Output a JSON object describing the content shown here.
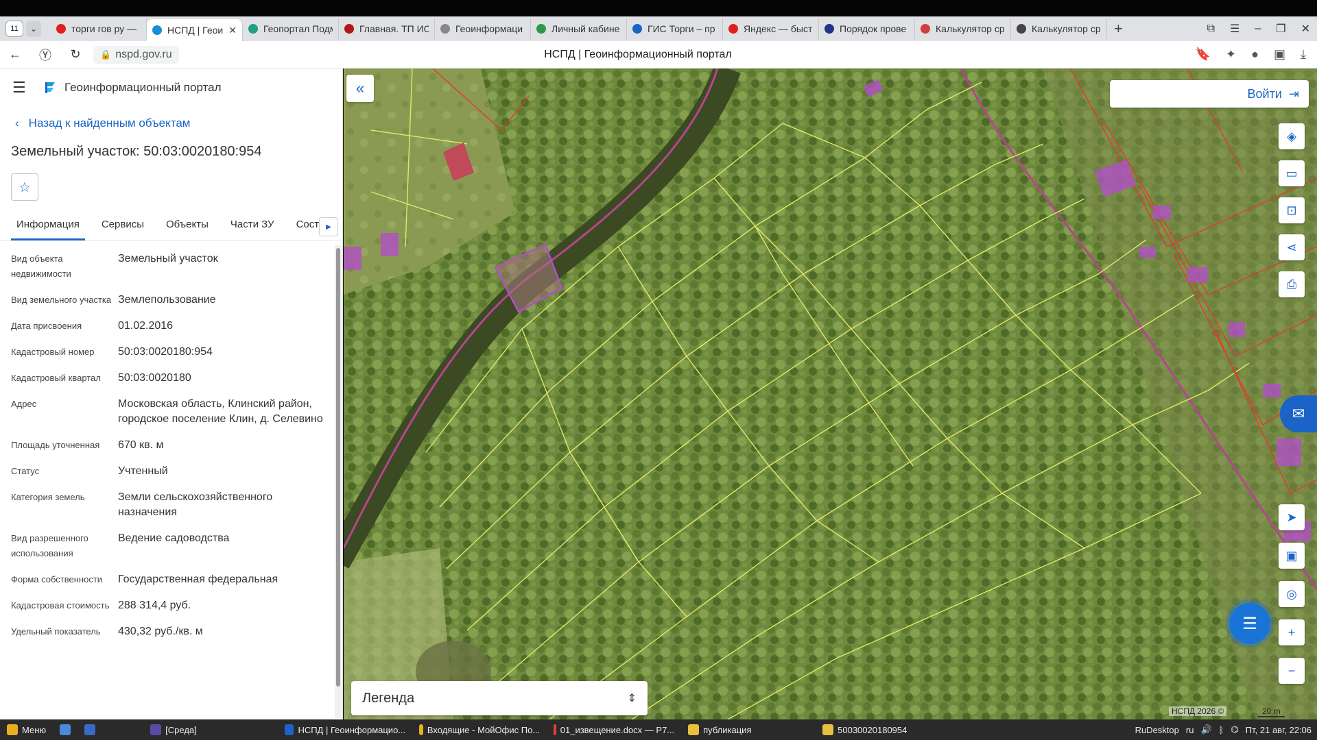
{
  "browser": {
    "tab_count": "11",
    "tabs": [
      {
        "label": "торги гов ру —",
        "color": "#e02020"
      },
      {
        "label": "НСПД | Геои",
        "color": "#1a8cd8",
        "active": true
      },
      {
        "label": "Геопортал Подм",
        "color": "#20a080"
      },
      {
        "label": "Главная. ТП ИС",
        "color": "#b01818"
      },
      {
        "label": "Геоинформаци",
        "color": "#888888"
      },
      {
        "label": "Личный кабине",
        "color": "#2a9a4a"
      },
      {
        "label": "ГИС Торги – пр",
        "color": "#1a64c8"
      },
      {
        "label": "Яндекс — быст",
        "color": "#e02020"
      },
      {
        "label": "Порядок прове",
        "color": "#223388"
      },
      {
        "label": "Калькулятор ср",
        "color": "#d04040"
      },
      {
        "label": "Калькулятор ср",
        "color": "#444444"
      }
    ],
    "url": "nspd.gov.ru",
    "page_title": "НСПД | Геоинформационный портал"
  },
  "sidebar": {
    "portal_title": "Геоинформационный портал",
    "back_link": "Назад к найденным объектам",
    "object_title": "Земельный участок: 50:03:0020180:954",
    "tabs": [
      "Информация",
      "Сервисы",
      "Объекты",
      "Части ЗУ",
      "Состав"
    ],
    "properties": [
      {
        "label": "Вид объекта недвижимости",
        "value": "Земельный участок"
      },
      {
        "label": "Вид земельного участка",
        "value": "Землепользование"
      },
      {
        "label": "Дата присвоения",
        "value": "01.02.2016"
      },
      {
        "label": "Кадастровый номер",
        "value": "50:03:0020180:954"
      },
      {
        "label": "Кадастровый квартал",
        "value": "50:03:0020180"
      },
      {
        "label": "Адрес",
        "value": "Московская область, Клинский район, городское поселение Клин, д. Селевино"
      },
      {
        "label": "Площадь уточненная",
        "value": "670 кв. м"
      },
      {
        "label": "Статус",
        "value": "Учтенный"
      },
      {
        "label": "Категория земель",
        "value": "Земли сельскохозяйственного назначения"
      },
      {
        "label": "Вид разрешенного использования",
        "value": "Ведение садоводства"
      },
      {
        "label": "Форма собственности",
        "value": "Государственная федеральная"
      },
      {
        "label": "Кадастровая стоимость",
        "value": "288 314,4 руб."
      },
      {
        "label": "Удельный показатель",
        "value": "430,32 руб./кв. м"
      }
    ]
  },
  "map": {
    "login_label": "Войти",
    "legend_label": "Легенда",
    "copyright": "НСПД 2026 ©",
    "scale": "20 m"
  },
  "taskbar": {
    "menu_label": "Меню",
    "items": [
      {
        "label": "[Среда]",
        "color": "#5a4aa8"
      },
      {
        "label": "НСПД | Геоинформацио...",
        "color": "#1a64c8"
      },
      {
        "label": "Входящие - МойОфис По...",
        "color": "#e8b020"
      },
      {
        "label": "01_извещение.docx — Р7...",
        "color": "#e04040"
      },
      {
        "label": "публикация",
        "color": "#e8c040"
      },
      {
        "label": "50030020180954",
        "color": "#e8c040"
      }
    ],
    "tray_app": "RuDesktop",
    "lang": "ru",
    "clock": "Пт, 21 авг, 22:06"
  }
}
